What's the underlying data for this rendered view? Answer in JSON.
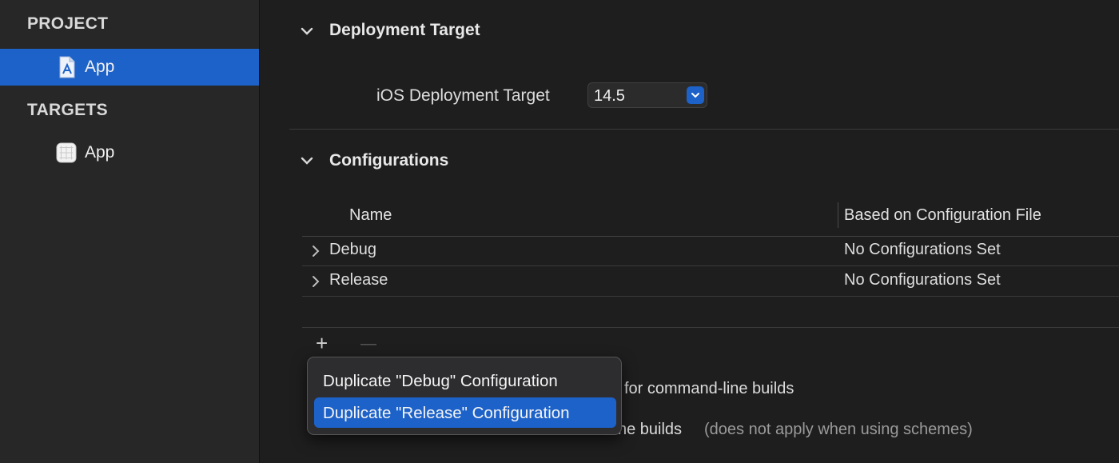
{
  "sidebar": {
    "project_header": "PROJECT",
    "targets_header": "TARGETS",
    "project_items": [
      {
        "label": "App",
        "icon": "project-file-icon",
        "selected": true
      }
    ],
    "target_items": [
      {
        "label": "App",
        "icon": "app-target-icon",
        "selected": false
      }
    ]
  },
  "deployment": {
    "title": "Deployment Target",
    "label": "iOS Deployment Target",
    "value": "14.5"
  },
  "configurations": {
    "title": "Configurations",
    "columns": [
      "Name",
      "Based on Configuration File"
    ],
    "rows": [
      {
        "name": "Debug",
        "file": "No Configurations Set"
      },
      {
        "name": "Release",
        "file": "No Configurations Set"
      }
    ],
    "add_label": "+",
    "remove_label": "—"
  },
  "background": {
    "line1": "for command-line builds",
    "line2": "ne builds",
    "line2_hint": "(does not apply when using schemes)"
  },
  "menu": {
    "items": [
      {
        "label": "Duplicate \"Debug\" Configuration",
        "highlighted": false
      },
      {
        "label": "Duplicate \"Release\" Configuration",
        "highlighted": true
      }
    ]
  },
  "colors": {
    "accent": "#1d62c9",
    "sidebar_bg": "#272727",
    "main_bg": "#1e1e1e"
  }
}
